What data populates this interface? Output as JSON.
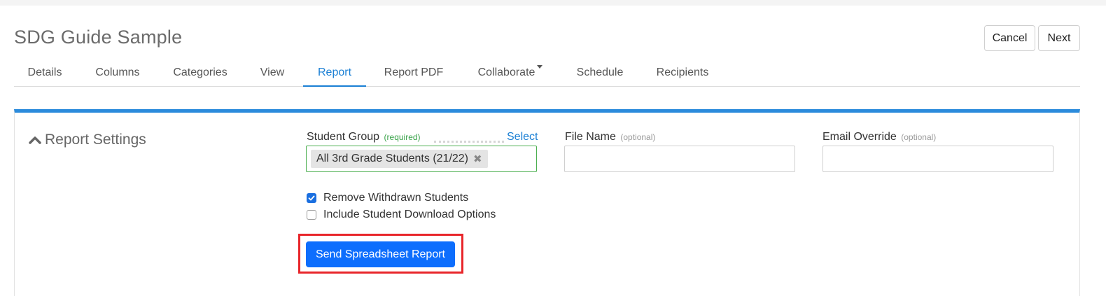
{
  "header": {
    "title": "SDG Guide Sample",
    "cancel_label": "Cancel",
    "next_label": "Next"
  },
  "tabs": [
    {
      "label": "Details",
      "active": false
    },
    {
      "label": "Columns",
      "active": false
    },
    {
      "label": "Categories",
      "active": false
    },
    {
      "label": "View",
      "active": false
    },
    {
      "label": "Report",
      "active": true
    },
    {
      "label": "Report PDF",
      "active": false
    },
    {
      "label": "Collaborate",
      "active": false,
      "has_dropdown": true
    },
    {
      "label": "Schedule",
      "active": false
    },
    {
      "label": "Recipients",
      "active": false
    }
  ],
  "report_settings": {
    "heading": "Report Settings",
    "heading_icon": "chevron-up-icon",
    "student_group": {
      "label": "Student Group",
      "required_note": "(required)",
      "select_link": "Select",
      "selected_chip": "All 3rd Grade Students (21/22)",
      "remove_glyph": "✖"
    },
    "file_name": {
      "label": "File Name",
      "optional_note": "(optional)",
      "value": "",
      "placeholder": ""
    },
    "email_override": {
      "label": "Email Override",
      "optional_note": "(optional)",
      "value": "",
      "placeholder": ""
    },
    "checkboxes": [
      {
        "label": "Remove Withdrawn Students",
        "checked": true
      },
      {
        "label": "Include Student Download Options",
        "checked": false
      }
    ],
    "send_button_label": "Send Spreadsheet Report"
  },
  "colors": {
    "accent": "#1a7fd4",
    "primary_button": "#0d6efd",
    "required_green": "#3aa34a",
    "highlight_red": "#e8262b"
  }
}
